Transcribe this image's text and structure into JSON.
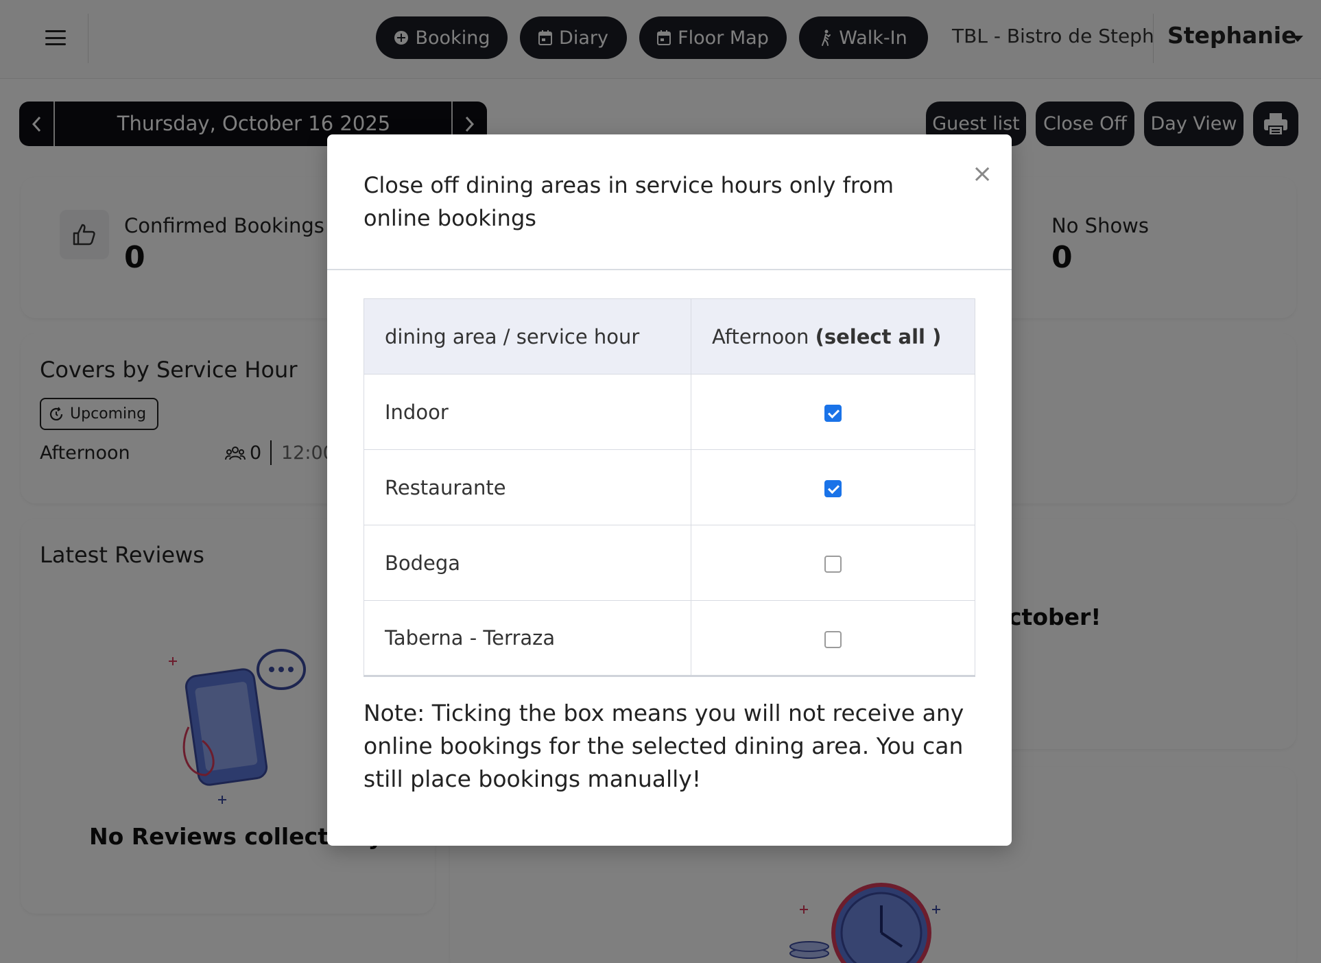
{
  "topbar": {
    "actions": [
      {
        "label": "Booking",
        "icon": "plus-circle-icon"
      },
      {
        "label": "Diary",
        "icon": "calendar-icon"
      },
      {
        "label": "Floor Map",
        "icon": "calendar-icon"
      },
      {
        "label": "Walk-In",
        "icon": "walking-person-icon"
      }
    ],
    "venue": "TBL - Bistro de Steph",
    "user": "Stephanie"
  },
  "datebar": {
    "date": "Thursday, October 16 2025"
  },
  "toolbar": {
    "guest_list": "Guest list",
    "close_off": "Close Off",
    "day_view": "Day View"
  },
  "stats": {
    "confirmed_label": "Confirmed Bookings",
    "confirmed_value": "0",
    "noshows_label": "No Shows",
    "noshows_value": "0"
  },
  "covers": {
    "title": "Covers by Service Hour",
    "badge": "Upcoming",
    "row_label": "Afternoon",
    "row_count": "0",
    "row_time": "12:00"
  },
  "reviews": {
    "title": "Latest Reviews",
    "empty": "No Reviews collected y"
  },
  "right_card": {
    "partial_text": "ctober!"
  },
  "modal": {
    "title": "Close off dining areas in service hours only from online bookings",
    "col1_header": "dining area / service hour",
    "col2_header_prefix": "Afternoon",
    "col2_header_select": "(select all )",
    "rows": [
      {
        "area": "Indoor",
        "checked": true
      },
      {
        "area": "Restaurante",
        "checked": true
      },
      {
        "area": "Bodega",
        "checked": false
      },
      {
        "area": "Taberna - Terraza",
        "checked": false
      }
    ],
    "note": "Note: Ticking the box means you will not receive any online bookings for the selected dining area. You can still place bookings manually!"
  },
  "colors": {
    "dark_button": "#1b1d24",
    "checkbox_blue": "#1a73e8",
    "table_header_bg": "#eceef6"
  }
}
